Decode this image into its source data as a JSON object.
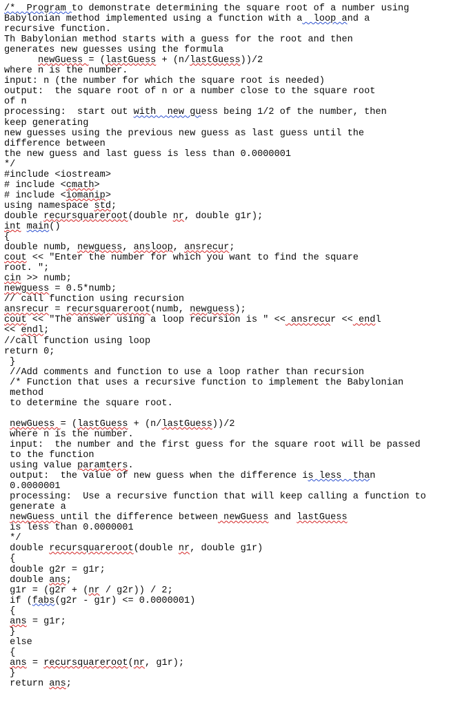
{
  "document": {
    "kind": "source-code-text",
    "language": "C++",
    "text_color": "#0a0a0a",
    "background_color": "#ffffff",
    "spellcheck_underline_colors": {
      "misspelling": "#d21f1f",
      "grammar": "#2a4fd0"
    },
    "lines": [
      {
        "id": 1,
        "text": "/*  Program to demonstrate determining the square root of a number using",
        "marks": [
          {
            "start": 0,
            "end": 12,
            "kind": "grammar"
          }
        ]
      },
      {
        "id": 2,
        "text": "Babylonian method implemented using a function with a  loop and a",
        "marks": [
          {
            "start": 53,
            "end": 61,
            "kind": "grammar"
          }
        ]
      },
      {
        "id": 3,
        "text": "recursive function.",
        "marks": []
      },
      {
        "id": 4,
        "text": "Th Babylonian method starts with a guess for the root and then",
        "marks": []
      },
      {
        "id": 5,
        "text": "generates new guesses using the formula",
        "marks": []
      },
      {
        "id": 6,
        "text": "      newGuess = (lastGuess + (n/lastGuess))/2",
        "marks": [
          {
            "start": 6,
            "end": 15,
            "kind": "misspelling"
          },
          {
            "start": 18,
            "end": 27,
            "kind": "misspelling"
          },
          {
            "start": 33,
            "end": 42,
            "kind": "misspelling"
          }
        ]
      },
      {
        "id": 7,
        "text": "where n is the number.",
        "marks": []
      },
      {
        "id": 8,
        "text": "input: n (the number for which the square root is needed)",
        "marks": []
      },
      {
        "id": 9,
        "text": "output:  the square root of n or a number close to the square root",
        "marks": []
      },
      {
        "id": 10,
        "text": "of n",
        "marks": []
      },
      {
        "id": 11,
        "text": "processing:  start out with  new guess being 1/2 of the number, then",
        "marks": [
          {
            "start": 23,
            "end": 35,
            "kind": "grammar"
          }
        ]
      },
      {
        "id": 12,
        "text": "keep generating",
        "marks": []
      },
      {
        "id": 13,
        "text": "new guesses using the previous new guess as last guess until the",
        "marks": []
      },
      {
        "id": 14,
        "text": "difference between",
        "marks": []
      },
      {
        "id": 15,
        "text": "the new guess and last guess is less than 0.0000001",
        "marks": []
      },
      {
        "id": 16,
        "text": "*/",
        "marks": []
      },
      {
        "id": 17,
        "text": "#include <iostream>",
        "marks": []
      },
      {
        "id": 18,
        "text": "# include <cmath>",
        "marks": [
          {
            "start": 11,
            "end": 16,
            "kind": "misspelling"
          }
        ]
      },
      {
        "id": 19,
        "text": "# include <iomanip>",
        "marks": [
          {
            "start": 11,
            "end": 18,
            "kind": "misspelling"
          }
        ]
      },
      {
        "id": 20,
        "text": "using namespace std;",
        "marks": [
          {
            "start": 16,
            "end": 19,
            "kind": "misspelling"
          }
        ]
      },
      {
        "id": 21,
        "text": "double recursquareroot(double nr, double g1r);",
        "marks": [
          {
            "start": 7,
            "end": 22,
            "kind": "misspelling"
          },
          {
            "start": 30,
            "end": 32,
            "kind": "misspelling"
          }
        ]
      },
      {
        "id": 22,
        "text": "int main()",
        "marks": [
          {
            "start": 0,
            "end": 3,
            "kind": "misspelling"
          },
          {
            "start": 4,
            "end": 8,
            "kind": "grammar"
          }
        ]
      },
      {
        "id": 23,
        "text": "{",
        "marks": []
      },
      {
        "id": 24,
        "text": "double numb, newguess, ansloop, ansrecur;",
        "marks": [
          {
            "start": 13,
            "end": 21,
            "kind": "misspelling"
          },
          {
            "start": 23,
            "end": 30,
            "kind": "misspelling"
          },
          {
            "start": 32,
            "end": 40,
            "kind": "misspelling"
          }
        ]
      },
      {
        "id": 25,
        "text": "cout << \"Enter the number for which you want to find the square",
        "marks": [
          {
            "start": 0,
            "end": 4,
            "kind": "misspelling"
          }
        ]
      },
      {
        "id": 26,
        "text": "root. \";",
        "marks": []
      },
      {
        "id": 27,
        "text": "cin >> numb;",
        "marks": [
          {
            "start": 0,
            "end": 3,
            "kind": "misspelling"
          }
        ]
      },
      {
        "id": 28,
        "text": "newguess = 0.5*numb;",
        "marks": [
          {
            "start": 0,
            "end": 8,
            "kind": "misspelling"
          }
        ]
      },
      {
        "id": 29,
        "text": "// call function using recursion",
        "marks": []
      },
      {
        "id": 30,
        "text": "ansrecur = recursquareroot(numb, newguess);",
        "marks": [
          {
            "start": 0,
            "end": 8,
            "kind": "misspelling"
          },
          {
            "start": 11,
            "end": 26,
            "kind": "misspelling"
          },
          {
            "start": 33,
            "end": 41,
            "kind": "misspelling"
          }
        ]
      },
      {
        "id": 31,
        "text": "cout << \"The answer using a loop recursion is \" << ansrecur << endl",
        "marks": [
          {
            "start": 0,
            "end": 4,
            "kind": "misspelling"
          },
          {
            "start": 50,
            "end": 58,
            "kind": "misspelling"
          },
          {
            "start": 62,
            "end": 66,
            "kind": "misspelling"
          }
        ]
      },
      {
        "id": 32,
        "text": "<< endl;",
        "marks": [
          {
            "start": 3,
            "end": 7,
            "kind": "misspelling"
          }
        ]
      },
      {
        "id": 33,
        "text": "//call function using loop",
        "marks": []
      },
      {
        "id": 34,
        "text": "return 0;",
        "marks": []
      },
      {
        "id": 35,
        "text": " }",
        "marks": []
      },
      {
        "id": 36,
        "text": " //Add comments and function to use a loop rather than recursion",
        "marks": []
      },
      {
        "id": 37,
        "text": " /* Function that uses a recursive function to implement the Babylonian",
        "marks": []
      },
      {
        "id": 38,
        "text": " method",
        "marks": []
      },
      {
        "id": 39,
        "text": " to determine the square root.",
        "marks": []
      },
      {
        "id": 40,
        "text": "",
        "marks": []
      },
      {
        "id": 41,
        "text": " newGuess = (lastGuess + (n/lastGuess))/2",
        "marks": [
          {
            "start": 1,
            "end": 10,
            "kind": "misspelling"
          },
          {
            "start": 13,
            "end": 22,
            "kind": "misspelling"
          },
          {
            "start": 28,
            "end": 37,
            "kind": "misspelling"
          }
        ]
      },
      {
        "id": 42,
        "text": " where n is the number.",
        "marks": []
      },
      {
        "id": 43,
        "text": " input:  the number and the first guess for the square root will be passed",
        "marks": []
      },
      {
        "id": 44,
        "text": " to the function",
        "marks": []
      },
      {
        "id": 45,
        "text": " using value paramters.",
        "marks": [
          {
            "start": 13,
            "end": 22,
            "kind": "misspelling"
          }
        ]
      },
      {
        "id": 46,
        "text": " output:  the value of new guess when the difference is less  than",
        "marks": [
          {
            "start": 54,
            "end": 65,
            "kind": "grammar"
          }
        ]
      },
      {
        "id": 47,
        "text": " 0.0000001",
        "marks": []
      },
      {
        "id": 48,
        "text": " processing:  Use a recursive function that will keep calling a function to",
        "marks": []
      },
      {
        "id": 49,
        "text": " generate a",
        "marks": []
      },
      {
        "id": 50,
        "text": " newGuess until the difference between newGuess and lastGuess",
        "marks": [
          {
            "start": 1,
            "end": 10,
            "kind": "misspelling"
          },
          {
            "start": 38,
            "end": 47,
            "kind": "misspelling"
          },
          {
            "start": 52,
            "end": 61,
            "kind": "misspelling"
          }
        ]
      },
      {
        "id": 51,
        "text": " is less than 0.0000001",
        "marks": []
      },
      {
        "id": 52,
        "text": " */",
        "marks": []
      },
      {
        "id": 53,
        "text": " double recursquareroot(double nr, double g1r)",
        "marks": [
          {
            "start": 8,
            "end": 23,
            "kind": "misspelling"
          },
          {
            "start": 31,
            "end": 33,
            "kind": "misspelling"
          }
        ]
      },
      {
        "id": 54,
        "text": " {",
        "marks": []
      },
      {
        "id": 55,
        "text": " double g2r = g1r;",
        "marks": []
      },
      {
        "id": 56,
        "text": " double ans;",
        "marks": [
          {
            "start": 8,
            "end": 11,
            "kind": "misspelling"
          }
        ]
      },
      {
        "id": 57,
        "text": " g1r = (g2r + (nr / g2r)) / 2;",
        "marks": [
          {
            "start": 15,
            "end": 17,
            "kind": "misspelling"
          }
        ]
      },
      {
        "id": 58,
        "text": " if (fabs(g2r - g1r) <= 0.0000001)",
        "marks": [
          {
            "start": 5,
            "end": 9,
            "kind": "grammar"
          }
        ]
      },
      {
        "id": 59,
        "text": " {",
        "marks": []
      },
      {
        "id": 60,
        "text": " ans = g1r;",
        "marks": [
          {
            "start": 1,
            "end": 4,
            "kind": "misspelling"
          }
        ]
      },
      {
        "id": 61,
        "text": " }",
        "marks": []
      },
      {
        "id": 62,
        "text": " else",
        "marks": []
      },
      {
        "id": 63,
        "text": " {",
        "marks": []
      },
      {
        "id": 64,
        "text": " ans = recursquareroot(nr, g1r);",
        "marks": [
          {
            "start": 1,
            "end": 4,
            "kind": "misspelling"
          },
          {
            "start": 7,
            "end": 22,
            "kind": "misspelling"
          },
          {
            "start": 23,
            "end": 25,
            "kind": "misspelling"
          }
        ]
      },
      {
        "id": 65,
        "text": " }",
        "marks": []
      },
      {
        "id": 66,
        "text": " return ans;",
        "marks": [
          {
            "start": 8,
            "end": 11,
            "kind": "misspelling"
          }
        ]
      }
    ]
  }
}
